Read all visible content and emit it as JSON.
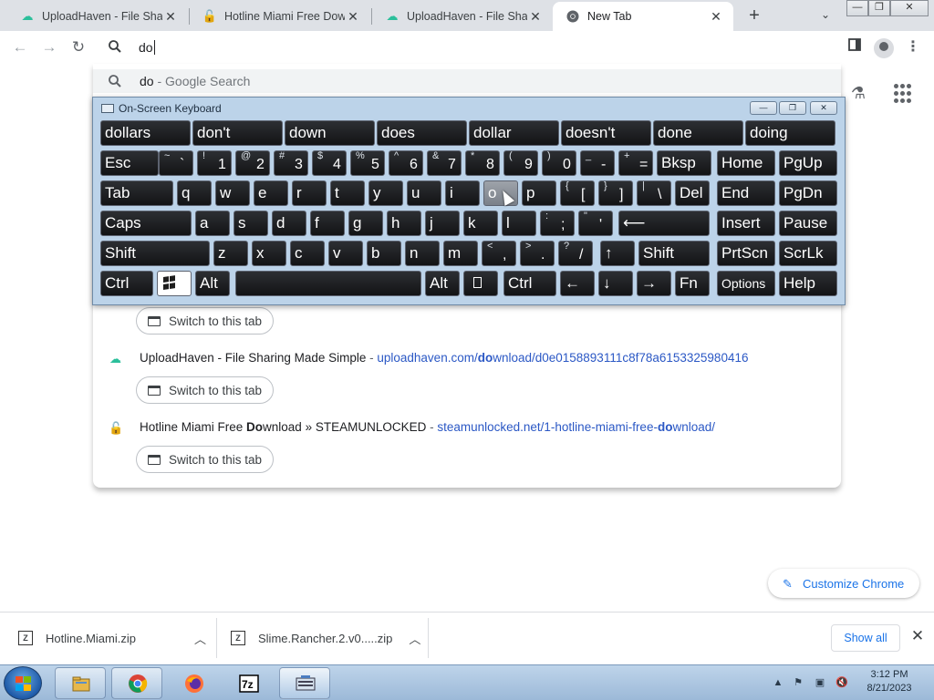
{
  "tabs": [
    {
      "title": "UploadHaven - File Sharing Made Simple",
      "favicon": "uploadhaven-icon"
    },
    {
      "title": "Hotline Miami Free Download » STEAMUNLOCKED",
      "favicon": "steamunlocked-icon"
    },
    {
      "title": "UploadHaven - File Sharing Made Simple",
      "favicon": "uploadhaven-icon"
    },
    {
      "title": "New Tab",
      "favicon": "chrome-icon",
      "active": true
    }
  ],
  "tab_close": "✕",
  "new_tab": "+",
  "window_controls": {
    "minimize": "—",
    "maximize": "❐",
    "close": "✕"
  },
  "omnibox": {
    "value": "do"
  },
  "suggestions": {
    "google": {
      "query": "do",
      "suffix": " - Google Search"
    },
    "rows": [
      {
        "pre": "UploadHaven - File Sharing Made Simple",
        "sep": " - ",
        "url_pre": "uploadhaven.com/",
        "url_bold": "do",
        "url_post": "wnload/d0e0158893111c8f78a6153325980416"
      },
      {
        "pre": "Hotline Miami Free ",
        "bold": "Do",
        "post": "wnload » STEAMUNLOCKED",
        "sep": " - ",
        "url_pre": "steamunlocked.net/1-hotline-miami-free-",
        "url_bold": "do",
        "url_post": "wnload/"
      }
    ],
    "switch_label": "Switch to this tab"
  },
  "osk": {
    "title": "On-Screen Keyboard",
    "predictions": [
      "dollars",
      "don't",
      "down",
      "does",
      "dollar",
      "doesn't",
      "done",
      "doing"
    ],
    "rows": [
      [
        {
          "l": "Esc"
        },
        {
          "s": "~",
          "m": "`"
        },
        {
          "s": "!",
          "m": "1"
        },
        {
          "s": "@",
          "m": "2"
        },
        {
          "s": "#",
          "m": "3"
        },
        {
          "s": "$",
          "m": "4"
        },
        {
          "s": "%",
          "m": "5"
        },
        {
          "s": "^",
          "m": "6"
        },
        {
          "s": "&",
          "m": "7"
        },
        {
          "s": "*",
          "m": "8"
        },
        {
          "s": "(",
          "m": "9"
        },
        {
          "s": ")",
          "m": "0"
        },
        {
          "s": "_",
          "m": "-"
        },
        {
          "s": "+",
          "m": "="
        },
        {
          "l": "Bksp"
        },
        {
          "l": "Home"
        },
        {
          "l": "PgUp"
        }
      ],
      [
        {
          "l": "Tab"
        },
        {
          "l": "q"
        },
        {
          "l": "w"
        },
        {
          "l": "e"
        },
        {
          "l": "r"
        },
        {
          "l": "t"
        },
        {
          "l": "y"
        },
        {
          "l": "u"
        },
        {
          "l": "i"
        },
        {
          "l": "o"
        },
        {
          "l": "p"
        },
        {
          "s": "{",
          "m": "["
        },
        {
          "s": "}",
          "m": "]"
        },
        {
          "s": "|",
          "m": "\\"
        },
        {
          "l": "Del"
        },
        {
          "l": "End"
        },
        {
          "l": "PgDn"
        }
      ],
      [
        {
          "l": "Caps"
        },
        {
          "l": "a"
        },
        {
          "l": "s"
        },
        {
          "l": "d"
        },
        {
          "l": "f"
        },
        {
          "l": "g"
        },
        {
          "l": "h"
        },
        {
          "l": "j"
        },
        {
          "l": "k"
        },
        {
          "l": "l"
        },
        {
          "s": ":",
          "m": ";"
        },
        {
          "s": "\"",
          "m": "'"
        },
        {
          "l": "⟵"
        },
        {
          "l": "Insert"
        },
        {
          "l": "Pause"
        }
      ],
      [
        {
          "l": "Shift"
        },
        {
          "l": "z"
        },
        {
          "l": "x"
        },
        {
          "l": "c"
        },
        {
          "l": "v"
        },
        {
          "l": "b"
        },
        {
          "l": "n"
        },
        {
          "l": "m"
        },
        {
          "s": "<",
          "m": ","
        },
        {
          "s": ">",
          "m": "."
        },
        {
          "s": "?",
          "m": "/"
        },
        {
          "l": "↑"
        },
        {
          "l": "Shift"
        },
        {
          "l": "PrtScn"
        },
        {
          "l": "ScrLk"
        }
      ],
      [
        {
          "l": "Ctrl"
        },
        {
          "l": ""
        },
        {
          "l": "Alt"
        },
        {
          "l": ""
        },
        {
          "l": "Alt"
        },
        {
          "l": ""
        },
        {
          "l": "Ctrl"
        },
        {
          "l": "←"
        },
        {
          "l": "↓"
        },
        {
          "l": "→"
        },
        {
          "l": "Fn"
        },
        {
          "l": "Options"
        },
        {
          "l": "Help"
        }
      ]
    ]
  },
  "customize": {
    "label": "Customize Chrome"
  },
  "downloads": {
    "items": [
      {
        "name": "Hotline.Miami.zip",
        "icon": "7z-archive-icon"
      },
      {
        "name": "Slime.Rancher.2.v0.....zip",
        "icon": "7z-archive-icon"
      }
    ],
    "show_all": "Show all"
  },
  "taskbar": {
    "apps": [
      "file-explorer-icon",
      "chrome-icon",
      "firefox-icon",
      "7zip-icon",
      "on-screen-keyboard-icon"
    ],
    "time": "3:12 PM",
    "date": "8/21/2023"
  },
  "colors": {
    "accent": "#1a73e8",
    "tabstrip": "#dee1e6",
    "osk_frame": "#bcd3e9",
    "key": "#1a1b1d"
  }
}
